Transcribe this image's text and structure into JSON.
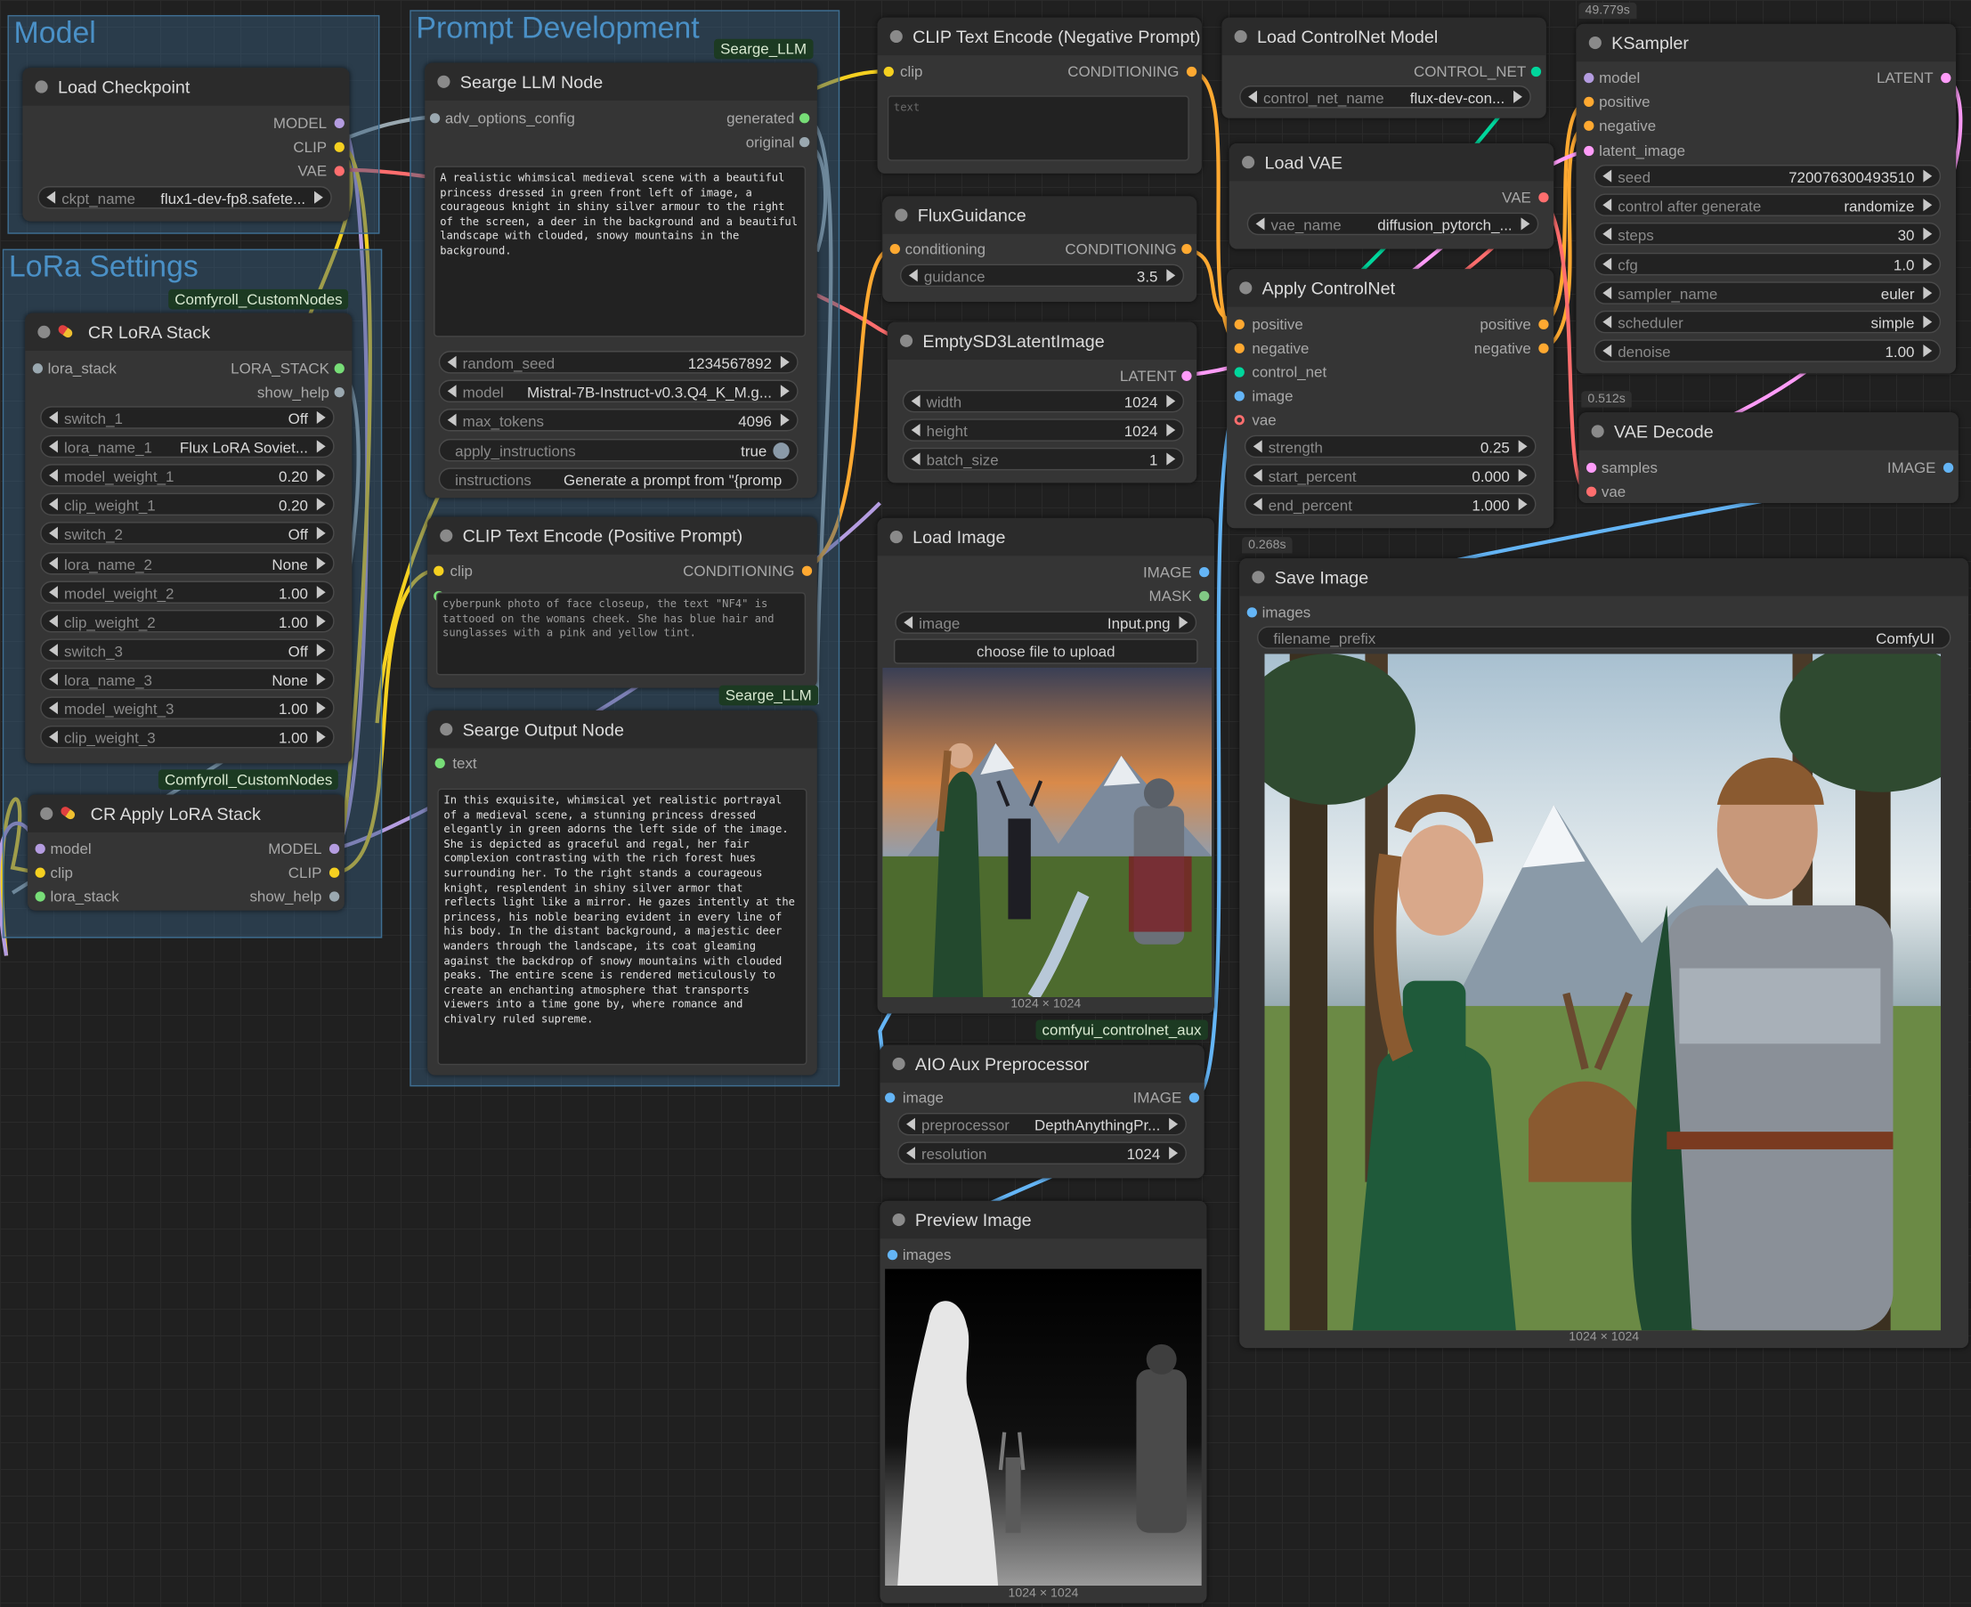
{
  "colors": {
    "model": "#b49ce0",
    "clip": "#f5d020",
    "vae": "#ff6e6e",
    "conditioning": "#ffa931",
    "latent": "#ff9cf9",
    "image": "#64b5f6",
    "mask": "#81c784",
    "control_net": "#00d69c",
    "string": "#77dd77",
    "generic": "#9aa8b0"
  },
  "groups": {
    "model": {
      "title": "Model"
    },
    "lora": {
      "title": "LoRa Settings"
    },
    "prompt": {
      "title": "Prompt Development"
    }
  },
  "badges": {
    "comfyroll_1": "Comfyroll_CustomNodes",
    "comfyroll_2": "Comfyroll_CustomNodes",
    "seargeLLM_1": "Searge_LLM",
    "seargeLLM_2": "Searge_LLM",
    "controlnet_aux": "comfyui_controlnet_aux"
  },
  "timers": {
    "ksampler": "49.779s",
    "vae_decode": "0.512s",
    "save_image": "0.268s"
  },
  "nodes": {
    "load_checkpoint": {
      "title": "Load Checkpoint",
      "outputs": [
        "MODEL",
        "CLIP",
        "VAE"
      ],
      "widgets": [
        {
          "name": "ckpt_name",
          "value": "flux1-dev-fp8.safete..."
        }
      ]
    },
    "cr_lora_stack": {
      "title": "CR LoRA Stack",
      "input": "lora_stack",
      "outputs": [
        "LORA_STACK",
        "show_help"
      ],
      "widgets": [
        {
          "name": "switch_1",
          "value": "Off"
        },
        {
          "name": "lora_name_1",
          "value": "Flux LoRA Soviet..."
        },
        {
          "name": "model_weight_1",
          "value": "0.20"
        },
        {
          "name": "clip_weight_1",
          "value": "0.20"
        },
        {
          "name": "switch_2",
          "value": "Off"
        },
        {
          "name": "lora_name_2",
          "value": "None"
        },
        {
          "name": "model_weight_2",
          "value": "1.00"
        },
        {
          "name": "clip_weight_2",
          "value": "1.00"
        },
        {
          "name": "switch_3",
          "value": "Off"
        },
        {
          "name": "lora_name_3",
          "value": "None"
        },
        {
          "name": "model_weight_3",
          "value": "1.00"
        },
        {
          "name": "clip_weight_3",
          "value": "1.00"
        }
      ]
    },
    "cr_apply_lora_stack": {
      "title": "CR Apply LoRA Stack",
      "inputs": [
        "model",
        "clip",
        "lora_stack"
      ],
      "outputs": [
        "MODEL",
        "CLIP",
        "show_help"
      ]
    },
    "searge_llm": {
      "title": "Searge LLM Node",
      "input": "adv_options_config",
      "outputs": [
        "generated",
        "original"
      ],
      "text": "A realistic whimsical medieval scene with a beautiful princess dressed in green front left of image, a courageous knight in shiny silver armour to the right of the screen, a deer in the background and a beautiful landscape with clouded, snowy mountains in the background.",
      "widgets": [
        {
          "name": "random_seed",
          "value": "1234567892"
        },
        {
          "name": "model",
          "value": "Mistral-7B-Instruct-v0.3.Q4_K_M.g..."
        },
        {
          "name": "max_tokens",
          "value": "4096"
        },
        {
          "name": "apply_instructions",
          "value": "true"
        },
        {
          "name": "instructions",
          "value": "Generate a prompt from \"{promp"
        }
      ]
    },
    "clip_pos": {
      "title": "CLIP Text Encode (Positive Prompt)",
      "input": "clip",
      "output": "CONDITIONING",
      "text": "cyberpunk photo of face closeup, the text \"NF4\" is tattooed on the womans cheek. She has blue hair and sunglasses with a pink and yellow tint."
    },
    "searge_output": {
      "title": "Searge Output Node",
      "input": "text",
      "text": "In this exquisite, whimsical yet realistic portrayal of a medieval scene, a stunning princess dressed elegantly in green adorns the left side of the image. She is depicted as graceful and regal, her fair complexion contrasting with the rich forest hues surrounding her. To the right stands a courageous knight, resplendent in shiny silver armor that reflects light like a mirror. He gazes intently at the princess, his noble bearing evident in every line of his body. In the distant background, a majestic deer wanders through the landscape, its coat gleaming against the backdrop of snowy mountains with clouded peaks. The entire scene is rendered meticulously to create an enchanting atmosphere that transports viewers into a time gone by, where romance and chivalry ruled supreme."
    },
    "clip_neg": {
      "title": "CLIP Text Encode (Negative Prompt)",
      "input": "clip",
      "output": "CONDITIONING",
      "placeholder": "text"
    },
    "flux_guidance": {
      "title": "FluxGuidance",
      "input": "conditioning",
      "output": "CONDITIONING",
      "widgets": [
        {
          "name": "guidance",
          "value": "3.5"
        }
      ]
    },
    "empty_latent": {
      "title": "EmptySD3LatentImage",
      "output": "LATENT",
      "widgets": [
        {
          "name": "width",
          "value": "1024"
        },
        {
          "name": "height",
          "value": "1024"
        },
        {
          "name": "batch_size",
          "value": "1"
        }
      ]
    },
    "load_image": {
      "title": "Load Image",
      "outputs": [
        "IMAGE",
        "MASK"
      ],
      "widgets": [
        {
          "name": "image",
          "value": "Input.png"
        }
      ],
      "upload": "choose file to upload",
      "dims": "1024 × 1024"
    },
    "aio_aux": {
      "title": "AIO Aux Preprocessor",
      "input": "image",
      "output": "IMAGE",
      "widgets": [
        {
          "name": "preprocessor",
          "value": "DepthAnythingPr..."
        },
        {
          "name": "resolution",
          "value": "1024"
        }
      ]
    },
    "preview_image": {
      "title": "Preview Image",
      "input": "images",
      "dims": "1024 × 1024"
    },
    "load_controlnet": {
      "title": "Load ControlNet Model",
      "output": "CONTROL_NET",
      "widgets": [
        {
          "name": "control_net_name",
          "value": "flux-dev-con..."
        }
      ]
    },
    "load_vae": {
      "title": "Load VAE",
      "output": "VAE",
      "widgets": [
        {
          "name": "vae_name",
          "value": "diffusion_pytorch_..."
        }
      ]
    },
    "apply_controlnet": {
      "title": "Apply ControlNet",
      "inputs": [
        "positive",
        "negative",
        "control_net",
        "image",
        "vae"
      ],
      "outputs": [
        "positive",
        "negative"
      ],
      "widgets": [
        {
          "name": "strength",
          "value": "0.25"
        },
        {
          "name": "start_percent",
          "value": "0.000"
        },
        {
          "name": "end_percent",
          "value": "1.000"
        }
      ]
    },
    "ksampler": {
      "title": "KSampler",
      "inputs": [
        "model",
        "positive",
        "negative",
        "latent_image"
      ],
      "output": "LATENT",
      "widgets": [
        {
          "name": "seed",
          "value": "720076300493510"
        },
        {
          "name": "control after generate",
          "value": "randomize"
        },
        {
          "name": "steps",
          "value": "30"
        },
        {
          "name": "cfg",
          "value": "1.0"
        },
        {
          "name": "sampler_name",
          "value": "euler"
        },
        {
          "name": "scheduler",
          "value": "simple"
        },
        {
          "name": "denoise",
          "value": "1.00"
        }
      ]
    },
    "vae_decode": {
      "title": "VAE Decode",
      "inputs": [
        "samples",
        "vae"
      ],
      "output": "IMAGE"
    },
    "save_image": {
      "title": "Save Image",
      "input": "images",
      "widgets": [
        {
          "name": "filename_prefix",
          "value": "ComfyUI"
        }
      ],
      "dims": "1024 × 1024"
    }
  }
}
